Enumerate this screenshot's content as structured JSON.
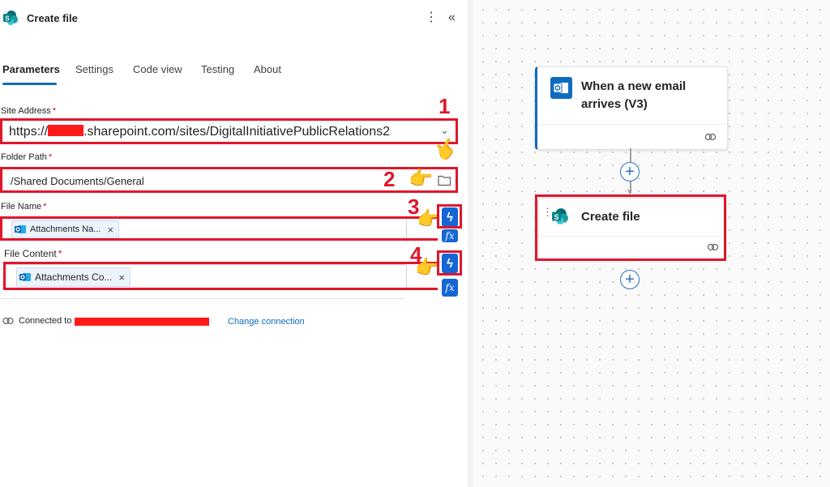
{
  "header": {
    "title": "Create file",
    "more_icon": "more-vertical-icon",
    "collapse_icon": "chevron-double-left-icon"
  },
  "tabs": [
    {
      "label": "Parameters",
      "active": true
    },
    {
      "label": "Settings"
    },
    {
      "label": "Code view"
    },
    {
      "label": "Testing"
    },
    {
      "label": "About"
    }
  ],
  "fields": {
    "site_address": {
      "label": "Site Address",
      "value_prefix": "https://",
      "value_suffix": ".sharepoint.com/sites/DigitalInitiativePublicRelations2"
    },
    "folder_path": {
      "label": "Folder Path",
      "value": "/Shared Documents/General"
    },
    "file_name": {
      "label": "File Name",
      "chip": "Attachments Na..."
    },
    "file_content": {
      "label": "File Content",
      "chip": "Attachments Co..."
    },
    "required_mark": "*"
  },
  "annotations": {
    "n1": "1",
    "n2": "2",
    "n3": "3",
    "n4": "4"
  },
  "connection": {
    "prefix": "Connected to",
    "change_label": "Change connection"
  },
  "canvas": {
    "trigger_title_line1": "When a new email",
    "trigger_title_line2": "arrives (V3)",
    "action_title": "Create file",
    "plus": "+"
  },
  "fx_label": "fx",
  "bolt_label": "ϟ",
  "hand": "👉",
  "close_x": "×",
  "colors": {
    "accent": "#0f6cbd",
    "annotation_red": "#e0162b",
    "node_blue": "#1466d6"
  }
}
